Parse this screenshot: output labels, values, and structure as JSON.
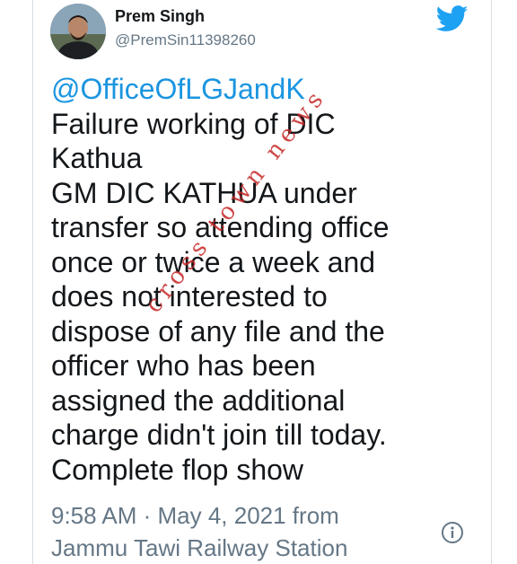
{
  "user": {
    "display_name": "Prem Singh",
    "handle": "@PremSin11398260"
  },
  "icons": {
    "brand": "twitter-bird-icon",
    "info": "info-icon",
    "brand_color": "#1DA1F2"
  },
  "tweet": {
    "mention": "@OfficeOfLGJandK",
    "lines": [
      "Failure working of DIC",
      "Kathua",
      "GM DIC KATHUA under",
      "transfer so attending office",
      "once or twice a week and",
      "does not interested to",
      "dispose of any  file and the",
      "officer who has been",
      "assigned the additional",
      "charge didn't join till today.",
      "Complete flop show"
    ]
  },
  "watermark": "cross town news",
  "meta": {
    "timestamp": "9:58 AM · May 4, 2021 from",
    "location": "Jammu Tawi Railway Station"
  }
}
